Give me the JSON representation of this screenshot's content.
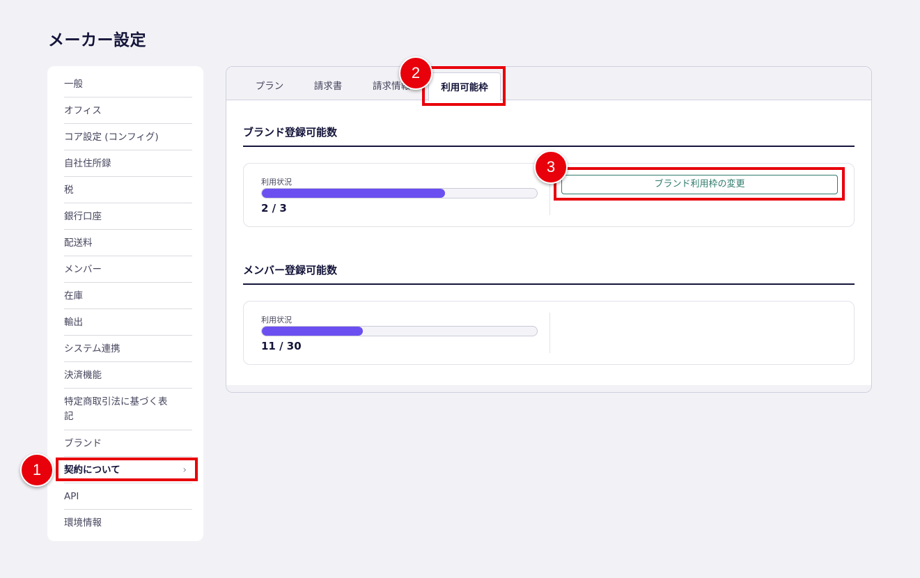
{
  "page": {
    "title": "メーカー設定"
  },
  "sidebar": {
    "items": [
      {
        "label": "一般"
      },
      {
        "label": "オフィス"
      },
      {
        "label": "コア設定 (コンフィグ)"
      },
      {
        "label": "自社住所録"
      },
      {
        "label": "税"
      },
      {
        "label": "銀行口座"
      },
      {
        "label": "配送料"
      },
      {
        "label": "メンバー"
      },
      {
        "label": "在庫"
      },
      {
        "label": "輸出"
      },
      {
        "label": "システム連携"
      },
      {
        "label": "決済機能"
      },
      {
        "label": "特定商取引法に基づく表記"
      },
      {
        "label": "ブランド"
      },
      {
        "label": "契約について",
        "active": true,
        "chevron": "›"
      },
      {
        "label": "API"
      },
      {
        "label": "環境情報"
      }
    ]
  },
  "tabs": [
    {
      "label": "プラン"
    },
    {
      "label": "請求書"
    },
    {
      "label": "請求情報"
    },
    {
      "label": "利用可能枠",
      "active": true
    }
  ],
  "sections": {
    "brand": {
      "title": "ブランド登録可能数",
      "usage_label": "利用状況",
      "used": 2,
      "total": 3,
      "usage_text": "2 / 3",
      "button_label": "ブランド利用枠の変更"
    },
    "member": {
      "title": "メンバー登録可能数",
      "usage_label": "利用状況",
      "used": 11,
      "total": 30,
      "usage_text": "11 / 30"
    }
  },
  "annotations": {
    "markers": [
      "1",
      "2",
      "3"
    ],
    "color": "#e8000b"
  },
  "colors": {
    "accent": "#6b4ff0",
    "button": "#2f7a6b",
    "text": "#14143a"
  }
}
